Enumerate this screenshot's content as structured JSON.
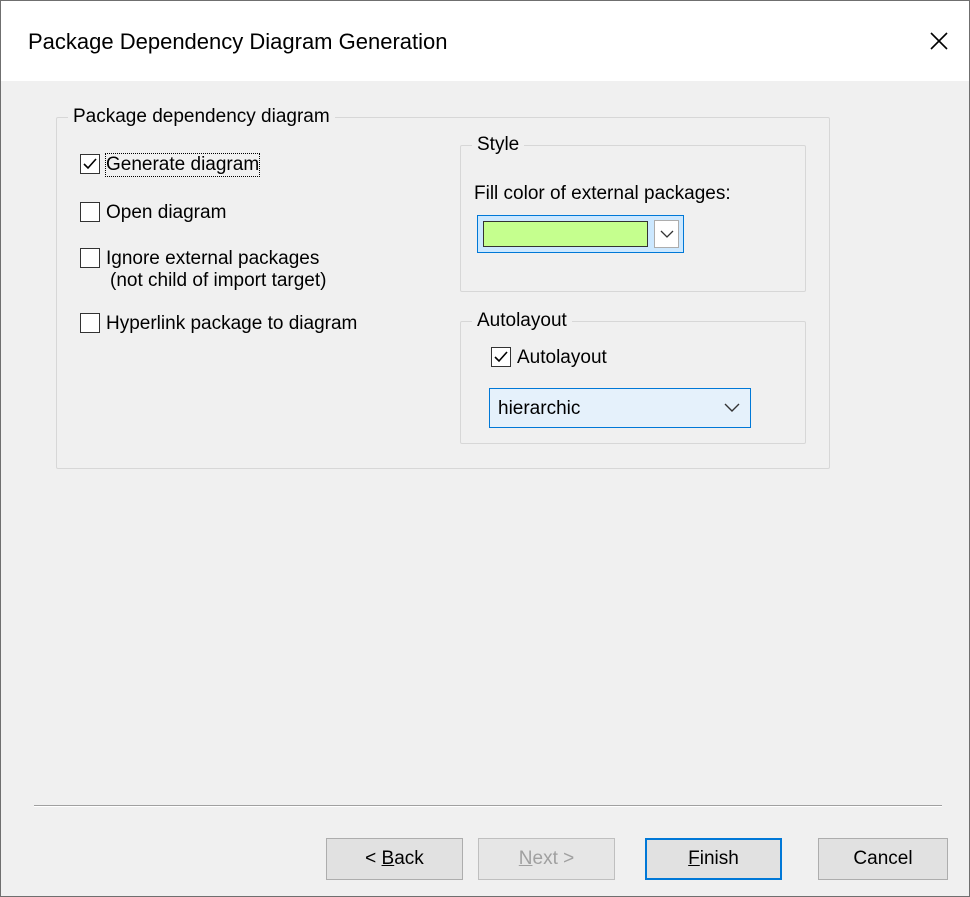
{
  "window": {
    "title": "Package Dependency Diagram Generation"
  },
  "group_main": {
    "legend": "Package dependency diagram",
    "options": [
      {
        "label": "Generate diagram",
        "checked": true
      },
      {
        "label": "Open diagram",
        "checked": false
      },
      {
        "label": "Ignore external packages",
        "sublabel": "(not child of import target)",
        "checked": false
      },
      {
        "label": "Hyperlink package to diagram",
        "checked": false
      }
    ]
  },
  "style_group": {
    "legend": "Style",
    "fill_label": "Fill color of external packages:",
    "fill_color": "#c5ff8e"
  },
  "autolayout_group": {
    "legend": "Autolayout",
    "checkbox_label": "Autolayout",
    "checked": true,
    "selected": "hierarchic"
  },
  "buttons": {
    "back": {
      "prefix": "< ",
      "mnemonic": "B",
      "rest": "ack"
    },
    "next": {
      "mnemonic": "N",
      "rest": "ext >"
    },
    "finish": {
      "mnemonic": "F",
      "rest": "inish"
    },
    "cancel": "Cancel"
  },
  "colors": {
    "accent": "#0078d7",
    "dialog_bg": "#f0f0f0"
  }
}
